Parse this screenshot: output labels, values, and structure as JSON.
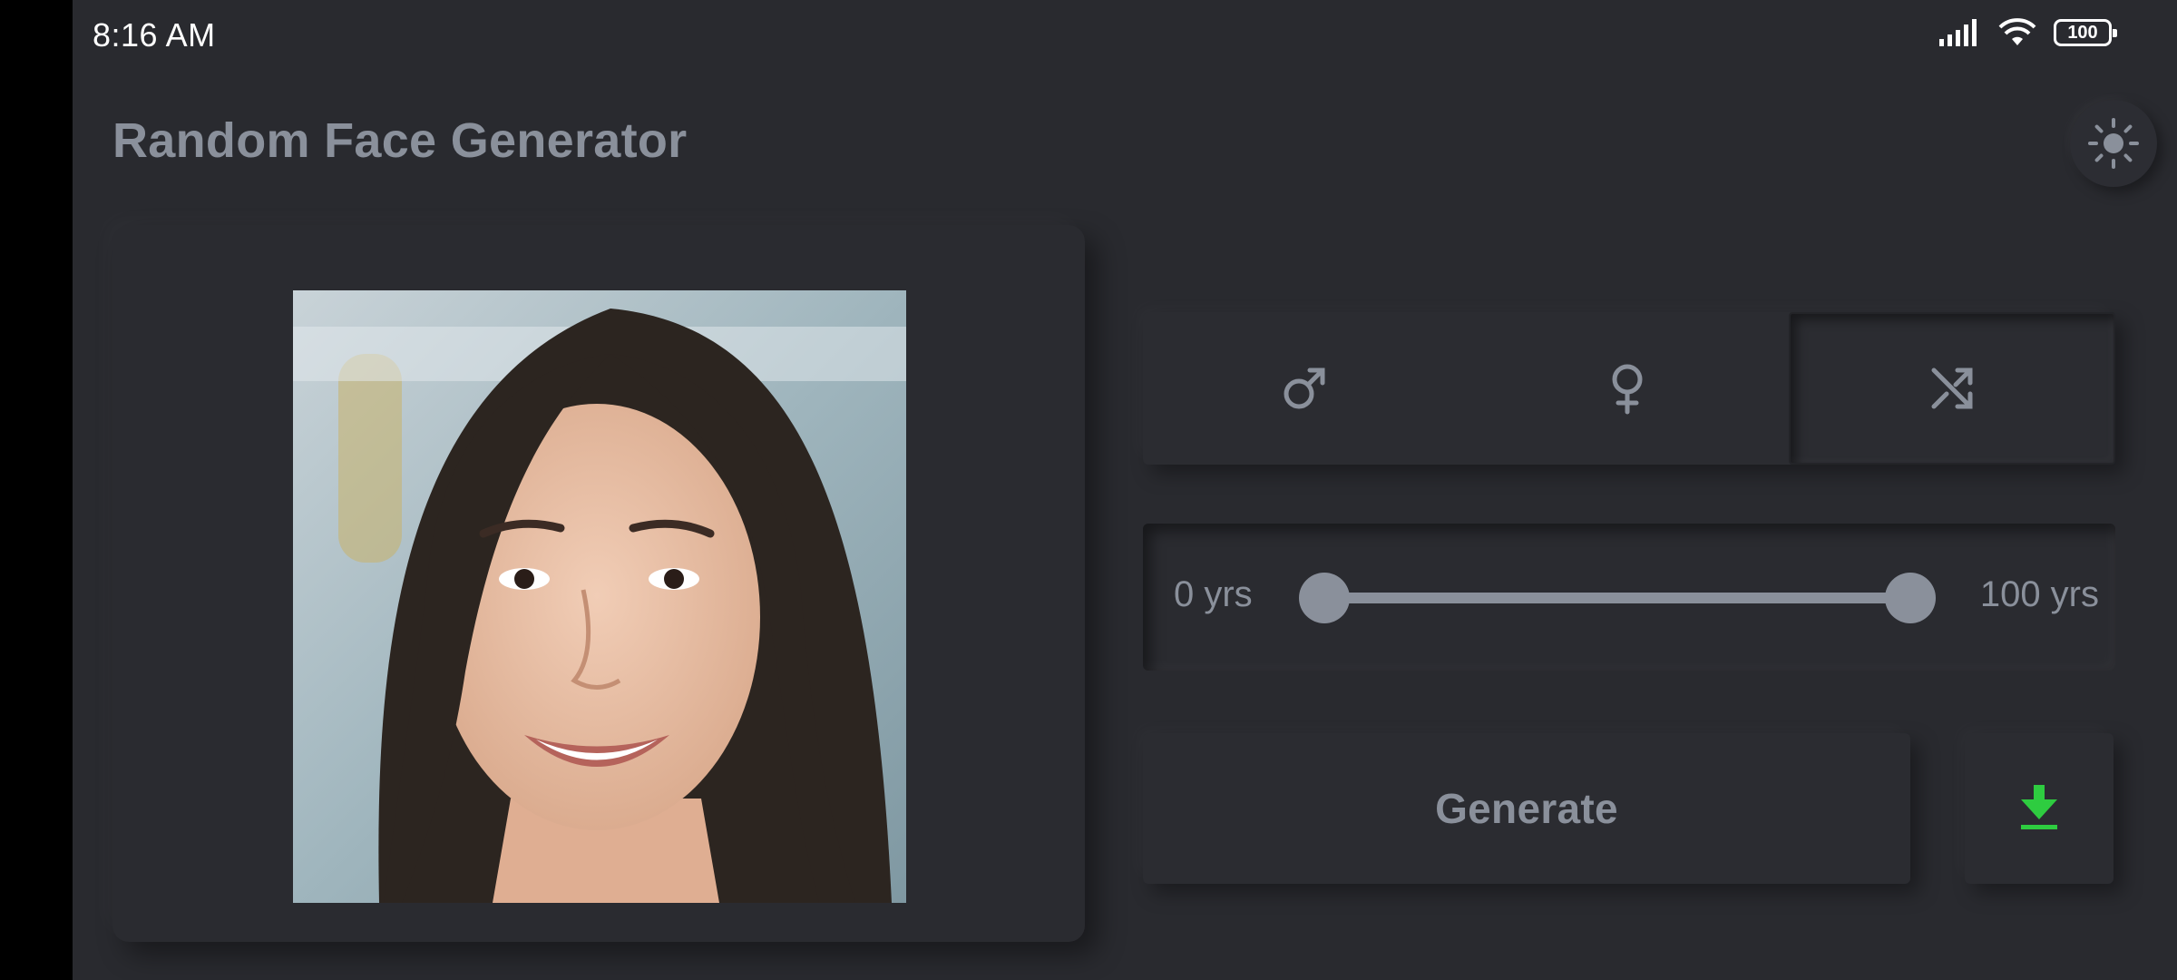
{
  "status_bar": {
    "time": "8:16 AM",
    "battery": "100",
    "icons": [
      "signal-icon",
      "wifi-icon",
      "battery-icon"
    ]
  },
  "header": {
    "title": "Random Face Generator",
    "theme_toggle_icon": "sun-icon"
  },
  "image": {
    "alt": "Generated face"
  },
  "gender_options": [
    {
      "icon": "male-icon",
      "selected": false
    },
    {
      "icon": "female-icon",
      "selected": false
    },
    {
      "icon": "shuffle-icon",
      "selected": true
    }
  ],
  "age_range": {
    "min_label": "0 yrs",
    "max_label": "100 yrs",
    "min_value": 0,
    "max_value": 100
  },
  "actions": {
    "generate_label": "Generate",
    "download_icon": "download-icon"
  },
  "colors": {
    "background": "#292a2f",
    "text_muted": "#8a909b",
    "accent_download": "#2ecc40"
  }
}
